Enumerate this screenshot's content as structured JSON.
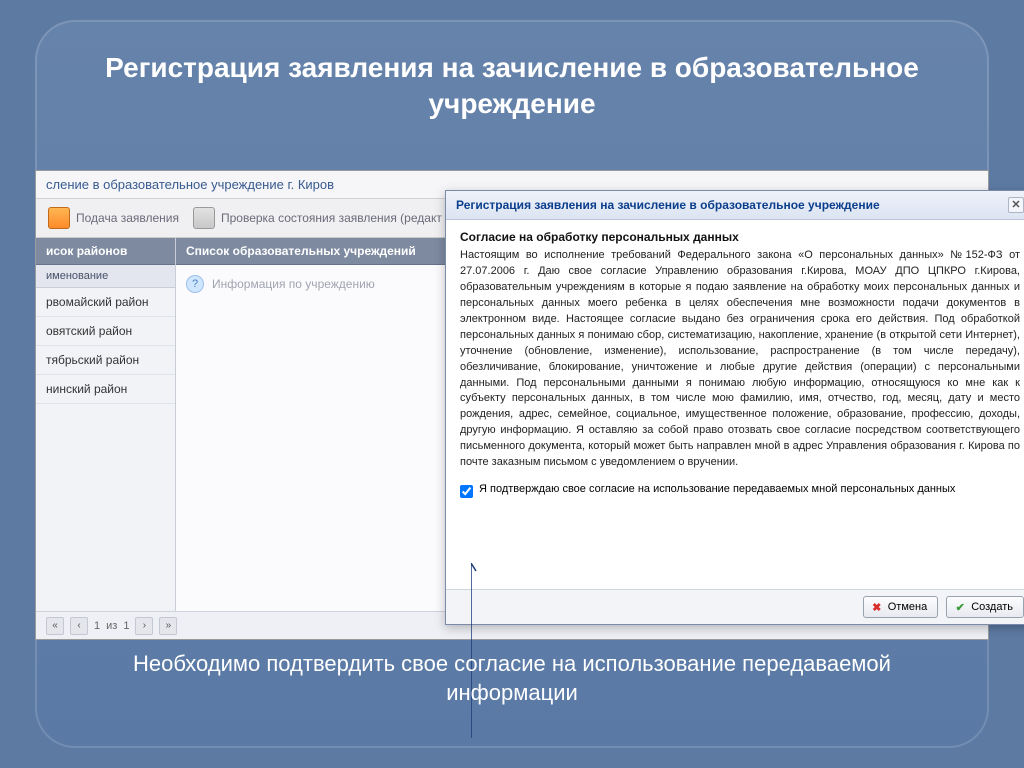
{
  "slide": {
    "title": "Регистрация заявления на зачисление в образовательное учреждение",
    "footer": "Необходимо подтвердить свое согласие на использование передаваемой информации"
  },
  "app": {
    "breadcrumb": "сление в образовательное учреждение г. Киров",
    "toolbar": {
      "submit": "Подача заявления",
      "check": "Проверка состояния заявления (редакт"
    },
    "sidebar": {
      "header": "исок районов",
      "subheader": "именование",
      "items": [
        "рвомайский район",
        "овятский район",
        "тябрьский район",
        "нинский район"
      ]
    },
    "main": {
      "header": "Список образовательных учреждений",
      "info": "Информация по учреждению"
    },
    "pager": {
      "page": "1",
      "of_label": "из",
      "total": "1"
    }
  },
  "modal": {
    "title": "Регистрация заявления на зачисление в образовательное учреждение",
    "heading": "Согласие на обработку персональных данных",
    "text": "Настоящим во исполнение требований Федерального закона «О персональных данных» №152-ФЗ от 27.07.2006 г. Даю свое согласие Управлению образования г.Кирова, МОАУ ДПО ЦПКРО г.Кирова, образовательным учреждениям в которые я подаю заявление на обработку моих персональных данных и персональных данных моего ребенка в целях обеспечения мне возможности подачи документов в электронном виде. Настоящее согласие выдано без ограничения срока его действия. Под обработкой персональных данных я понимаю сбор, систематизацию, накопление, хранение (в открытой сети Интернет), уточнение (обновление, изменение), использование, распространение (в том числе передачу), обезличивание, блокирование, уничтожение и любые другие действия (операции) с персональными данными. Под персональными данными я понимаю любую информацию, относящуюся ко мне как к субъекту персональных данных, в том числе мою фамилию, имя, отчество, год, месяц, дату и место рождения, адрес, семейное, социальное, имущественное положение, образование, профессию, доходы, другую информацию. Я оставляю за собой право отозвать свое согласие посредством соответствующего письменного документа, который может быть направлен мной в адрес Управления образования г. Кирова по почте заказным письмом с уведомлением о вручении.",
    "checkbox_label": "Я подтверждаю свое согласие на использование передаваемых мной персональных данных",
    "checkbox_checked": true,
    "buttons": {
      "cancel": "Отмена",
      "create": "Создать"
    }
  }
}
